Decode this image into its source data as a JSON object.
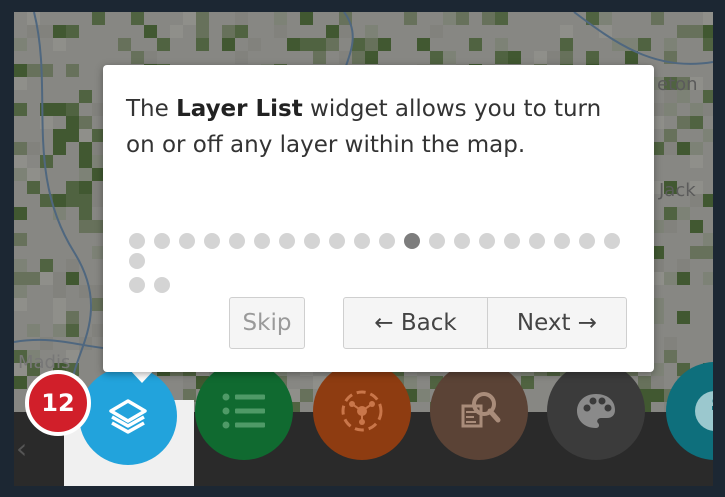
{
  "map": {
    "labels": [
      "eton",
      "Jack",
      "Madis"
    ]
  },
  "popup": {
    "text_before": "The ",
    "text_bold": "Layer List",
    "text_after": " widget allows you to turn on or off any layer within the map.",
    "total_steps": 23,
    "current_step": 12,
    "skip_label": "Skip",
    "back_label": "← Back",
    "next_label": "Next →"
  },
  "dock": {
    "badge": "12",
    "widgets": [
      {
        "name": "layer-list",
        "icon": "layers-icon",
        "color": "#22a3dc"
      },
      {
        "name": "legend",
        "icon": "legend-list-icon",
        "color": "#106a30"
      },
      {
        "name": "analysis",
        "icon": "network-icon",
        "color": "#8e3c11"
      },
      {
        "name": "query",
        "icon": "search-report-icon",
        "color": "#5b4336"
      },
      {
        "name": "basemap",
        "icon": "palette-icon",
        "color": "#3b3b3b"
      },
      {
        "name": "about",
        "icon": "info-icon",
        "color": "#0e6f7c"
      }
    ]
  },
  "colors": {
    "popup_bg": "#ffffff",
    "badge_bg": "#d11f2a",
    "active_dot": "#7d7d7d",
    "inactive_dot": "#d4d4d4"
  }
}
